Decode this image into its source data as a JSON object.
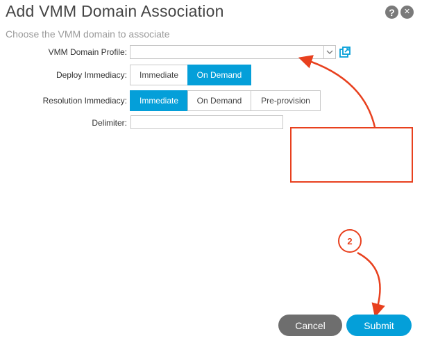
{
  "dialog": {
    "title": "Add VMM Domain Association",
    "subtitle": "Choose the VMM domain to associate",
    "help_icon": "?",
    "close_icon": "✕"
  },
  "form": {
    "vmm_domain_profile": {
      "label": "VMM Domain Profile:",
      "value": ""
    },
    "deploy_immediacy": {
      "label": "Deploy Immediacy:",
      "options": [
        "Immediate",
        "On Demand"
      ],
      "selected": "On Demand"
    },
    "resolution_immediacy": {
      "label": "Resolution Immediacy:",
      "options": [
        "Immediate",
        "On Demand",
        "Pre-provision"
      ],
      "selected": "Immediate"
    },
    "delimiter": {
      "label": "Delimiter:",
      "value": ""
    }
  },
  "footer": {
    "cancel_label": "Cancel",
    "submit_label": "Submit"
  },
  "annotations": {
    "step_number": "2",
    "color": "#e8401e"
  },
  "colors": {
    "accent": "#049fd9",
    "cancel": "#6e6e6e"
  },
  "icons": {
    "dropdown": "chevron-down-icon",
    "open_external": "open-external-icon",
    "help": "help-icon",
    "close": "close-icon"
  }
}
